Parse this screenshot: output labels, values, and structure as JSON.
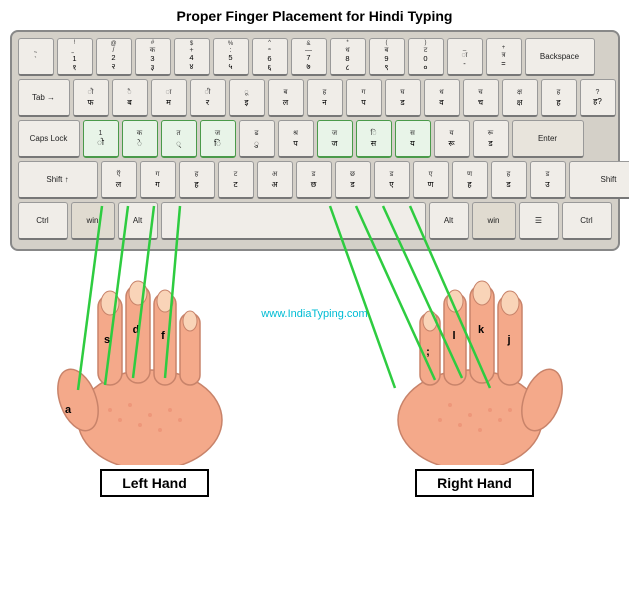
{
  "title": "Proper Finger Placement for Hindi Typing",
  "watermark": "www.IndiaTyping.com",
  "left_hand_label": "Left Hand",
  "right_hand_label": "Right Hand",
  "keyboard": {
    "rows": [
      {
        "keys": [
          {
            "top": "~",
            "bottom": "`",
            "sub_top": "",
            "sub_bottom": ""
          },
          {
            "top": "!",
            "bottom": "1",
            "sub_top": "॒",
            "sub_bottom": "१"
          },
          {
            "top": "@",
            "bottom": "2",
            "sub_top": "/",
            "sub_bottom": "२"
          },
          {
            "top": "#",
            "bottom": "3",
            "sub_top": "क",
            "sub_bottom": "३"
          },
          {
            "top": "$",
            "bottom": "4",
            "sub_top": "+",
            "sub_bottom": "४"
          },
          {
            "top": "%",
            "bottom": "5",
            "sub_top": ":",
            "sub_bottom": "५"
          },
          {
            "top": "^",
            "bottom": "6",
            "sub_top": "॰",
            "sub_bottom": "६"
          },
          {
            "top": "&",
            "bottom": "7",
            "sub_top": "—",
            "sub_bottom": "७"
          },
          {
            "top": "*",
            "bottom": "8",
            "sub_top": "ध",
            "sub_bottom": "८"
          },
          {
            "top": "(",
            "bottom": "9",
            "sub_top": "ब",
            "sub_bottom": "९"
          },
          {
            "top": ")",
            "bottom": "0",
            "sub_top": "ट",
            "sub_bottom": "०"
          },
          {
            "top": "_",
            "bottom": "-",
            "sub_top": "ा",
            "sub_bottom": ""
          },
          {
            "top": "+",
            "bottom": "=",
            "sub_top": "त्र",
            "sub_bottom": ""
          },
          {
            "type": "backspace",
            "label": "Backspace"
          }
        ]
      },
      {
        "keys": [
          {
            "type": "tab",
            "label": "Tab"
          },
          {
            "top": "",
            "bottom": "फ",
            "sub_top": "",
            "sub_bottom": ""
          },
          {
            "top": "",
            "bottom": "ब",
            "sub_top": "",
            "sub_bottom": ""
          },
          {
            "top": "",
            "bottom": "म",
            "sub_top": "",
            "sub_bottom": ""
          },
          {
            "top": "",
            "bottom": "र",
            "sub_top": "",
            "sub_bottom": ""
          },
          {
            "top": "",
            "bottom": "इ",
            "sub_top": "",
            "sub_bottom": ""
          },
          {
            "top": "",
            "bottom": "ल",
            "sub_top": "",
            "sub_bottom": ""
          },
          {
            "top": "",
            "bottom": "न",
            "sub_top": "",
            "sub_bottom": ""
          },
          {
            "top": "",
            "bottom": "प",
            "sub_top": "",
            "sub_bottom": ""
          },
          {
            "top": "",
            "bottom": "ड",
            "sub_top": "",
            "sub_bottom": ""
          },
          {
            "top": "",
            "bottom": "व",
            "sub_top": "",
            "sub_bottom": ""
          },
          {
            "top": "",
            "bottom": "च",
            "sub_top": "",
            "sub_bottom": ""
          },
          {
            "top": "",
            "bottom": "क्ष",
            "sub_top": "",
            "sub_bottom": ""
          },
          {
            "top": "",
            "bottom": "ह",
            "sub_top": "",
            "sub_bottom": ""
          },
          {
            "top": "",
            "bottom": "ह?",
            "sub_top": "",
            "sub_bottom": ""
          }
        ]
      },
      {
        "keys": [
          {
            "type": "capslock",
            "label": "Caps Lock"
          },
          {
            "top": "",
            "bottom": "1",
            "sub_top": "",
            "sub_bottom": ""
          },
          {
            "top": "",
            "bottom": "क",
            "sub_top": "",
            "sub_bottom": ""
          },
          {
            "top": "",
            "bottom": "त",
            "sub_top": "",
            "sub_bottom": ""
          },
          {
            "top": "",
            "bottom": "ज",
            "sub_top": "",
            "sub_bottom": ""
          },
          {
            "top": "",
            "bottom": "ढ",
            "sub_top": "",
            "sub_bottom": ""
          },
          {
            "top": "",
            "bottom": "श्र",
            "sub_top": "",
            "sub_bottom": ""
          },
          {
            "top": "",
            "bottom": "ज",
            "sub_top": "",
            "sub_bottom": ""
          },
          {
            "top": "",
            "bottom": "ि",
            "sub_top": "",
            "sub_bottom": ""
          },
          {
            "top": "",
            "bottom": "स",
            "sub_top": "",
            "sub_bottom": ""
          },
          {
            "top": "",
            "bottom": "य",
            "sub_top": "",
            "sub_bottom": ""
          },
          {
            "top": "",
            "bottom": "रू",
            "sub_top": "",
            "sub_bottom": ""
          },
          {
            "top": "",
            "bottom": "ड",
            "sub_top": "",
            "sub_bottom": ""
          },
          {
            "type": "enter",
            "label": "Enter"
          }
        ]
      },
      {
        "keys": [
          {
            "type": "shift-l",
            "label": "Shift ↑"
          },
          {
            "top": "",
            "bottom": "ल",
            "sub_top": "",
            "sub_bottom": ""
          },
          {
            "top": "",
            "bottom": "ग",
            "sub_top": "",
            "sub_bottom": ""
          },
          {
            "top": "",
            "bottom": "ह",
            "sub_top": "",
            "sub_bottom": ""
          },
          {
            "top": "",
            "bottom": "ट",
            "sub_top": "",
            "sub_bottom": ""
          },
          {
            "top": "",
            "bottom": "अ",
            "sub_top": "",
            "sub_bottom": ""
          },
          {
            "top": "",
            "bottom": "ड",
            "sub_top": "",
            "sub_bottom": ""
          },
          {
            "top": "",
            "bottom": "छ",
            "sub_top": "",
            "sub_bottom": ""
          },
          {
            "top": "",
            "bottom": "ड",
            "sub_top": "",
            "sub_bottom": ""
          },
          {
            "top": "",
            "bottom": "ए",
            "sub_top": "",
            "sub_bottom": ""
          },
          {
            "top": "",
            "bottom": "ण",
            "sub_top": "",
            "sub_bottom": ""
          },
          {
            "top": "",
            "bottom": "ह",
            "sub_top": "",
            "sub_bottom": ""
          },
          {
            "top": "",
            "bottom": "ड",
            "sub_top": "",
            "sub_bottom": ""
          },
          {
            "top": "",
            "bottom": "उ",
            "sub_top": "",
            "sub_bottom": ""
          },
          {
            "type": "shift-r",
            "label": "Shift"
          }
        ]
      },
      {
        "keys": [
          {
            "type": "ctrl",
            "label": "Ctrl"
          },
          {
            "type": "win",
            "label": "win"
          },
          {
            "type": "alt",
            "label": "Alt"
          },
          {
            "type": "space",
            "label": ""
          },
          {
            "type": "alt",
            "label": "Alt"
          },
          {
            "type": "win",
            "label": "win"
          },
          {
            "type": "menu",
            "label": "☰"
          },
          {
            "type": "ctrl",
            "label": "Ctrl"
          }
        ]
      }
    ]
  }
}
